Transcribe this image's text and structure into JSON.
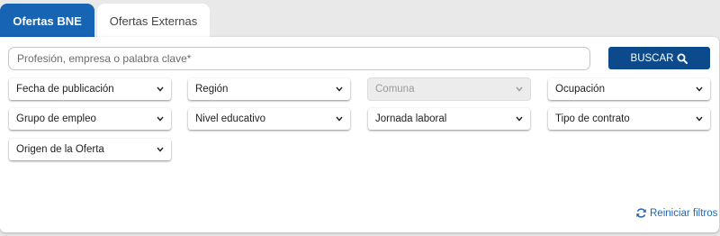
{
  "tabs": [
    {
      "label": "Ofertas BNE",
      "active": true
    },
    {
      "label": "Ofertas Externas",
      "active": false
    }
  ],
  "search": {
    "placeholder": "Profesión, empresa o palabra clave*",
    "value": "",
    "button_label": "BUSCAR",
    "button_icon": "search-icon"
  },
  "filters": {
    "fecha": "Fecha de publicación",
    "region": "Región",
    "comuna": "Comuna",
    "ocupacion": "Ocupación",
    "grupo": "Grupo de empleo",
    "nivel": "Nivel educativo",
    "jornada": "Jornada laboral",
    "tipo": "Tipo de contrato",
    "origen": "Origen de la Oferta"
  },
  "reset": {
    "label": "Reiniciar filtros",
    "icon": "refresh-icon"
  },
  "colors": {
    "primary": "#1763b4",
    "button": "#0d4a8c",
    "link": "#1f67b1",
    "background": "#e9e9e9"
  }
}
